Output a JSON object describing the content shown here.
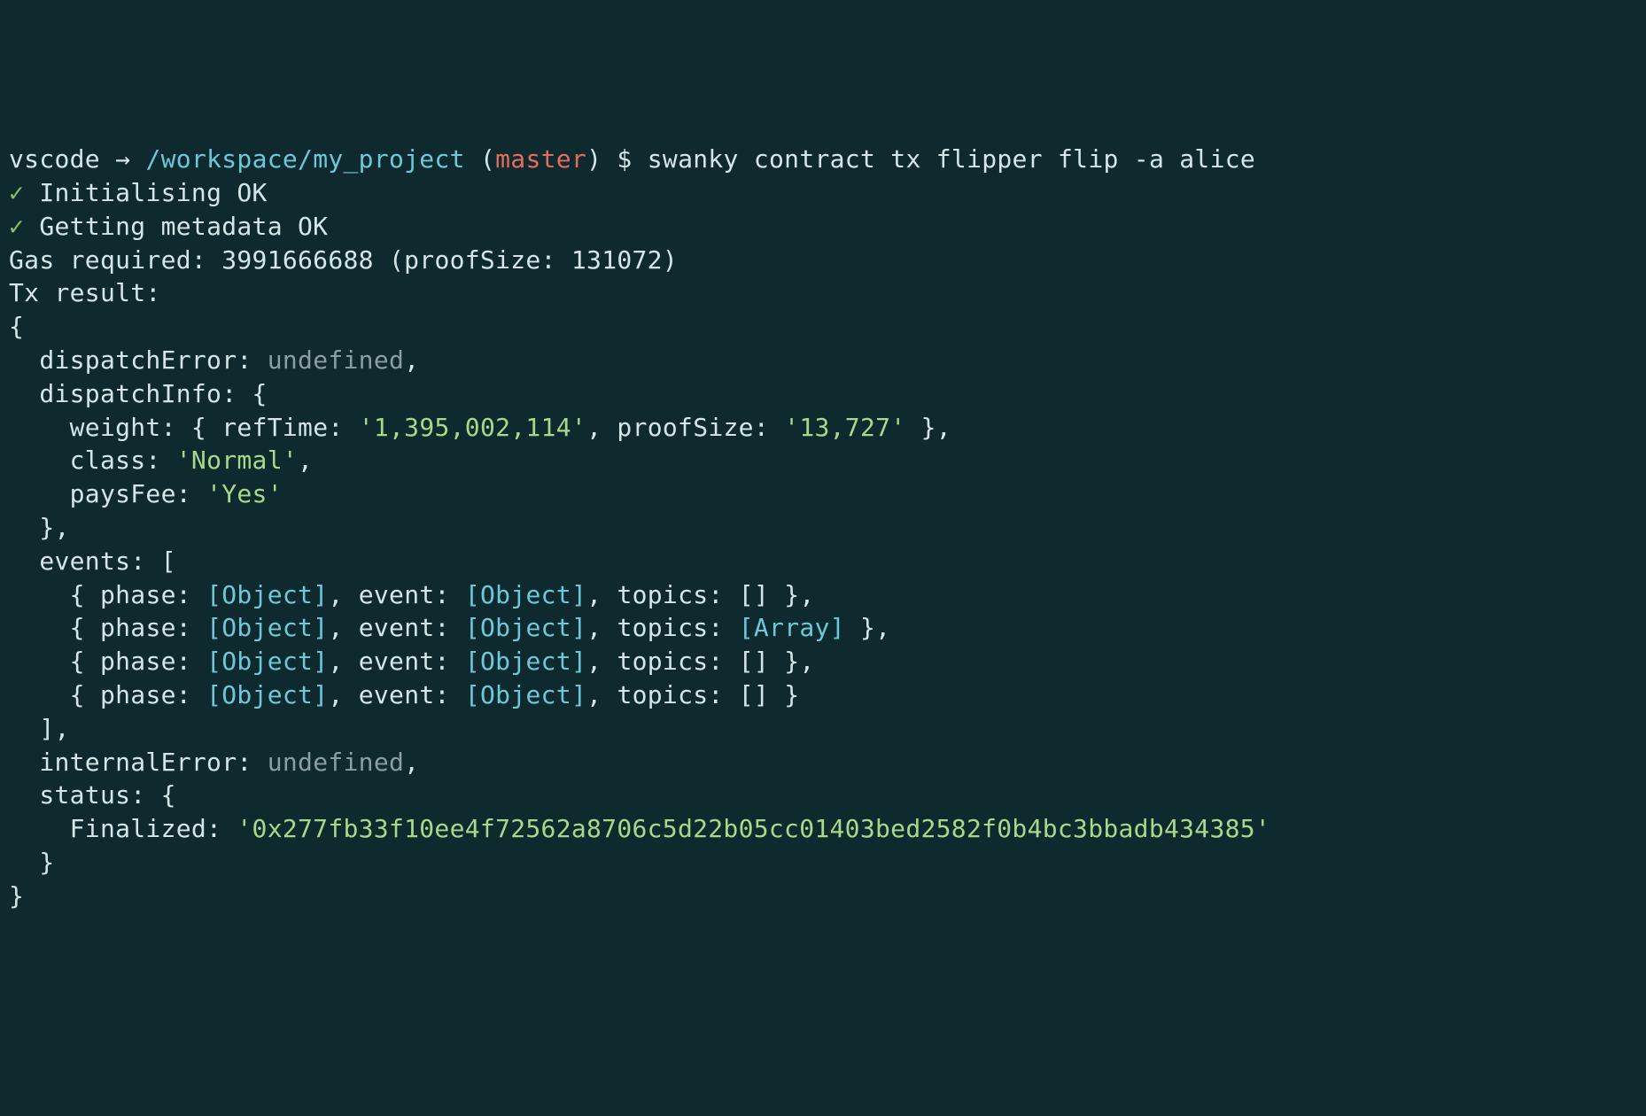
{
  "prompt": {
    "user": "vscode",
    "arrow": "→",
    "path": "/workspace/my_project",
    "branch": "master",
    "dollar": "$",
    "command": "swanky contract tx flipper flip -a alice"
  },
  "status": {
    "check": "✓",
    "init": "Initialising OK",
    "metadata": "Getting metadata OK"
  },
  "gas": {
    "label": "Gas required:",
    "value": "3991666688",
    "proofLabel": "proofSize:",
    "proofValue": "131072"
  },
  "txResultLabel": "Tx result:",
  "result": {
    "dispatchErrorKey": "dispatchError:",
    "dispatchErrorVal": "undefined",
    "dispatchInfoKey": "dispatchInfo:",
    "weightKey": "weight:",
    "refTimeKey": "refTime:",
    "refTimeVal": "'1,395,002,114'",
    "proofSizeKey": "proofSize:",
    "proofSizeVal": "'13,727'",
    "classKey": "class:",
    "classVal": "'Normal'",
    "paysFeeKey": "paysFee:",
    "paysFeeVal": "'Yes'",
    "eventsKey": "events:",
    "phaseKey": "phase:",
    "eventKey": "event:",
    "topicsKey": "topics:",
    "objectRef": "[Object]",
    "arrayRef": "[Array]",
    "emptyArr": "[]",
    "internalErrorKey": "internalError:",
    "internalErrorVal": "undefined",
    "statusKey": "status:",
    "finalizedKey": "Finalized:",
    "finalizedVal": "'0x277fb33f10ee4f72562a8706c5d22b05cc01403bed2582f0b4bc3bbadb434385'"
  }
}
